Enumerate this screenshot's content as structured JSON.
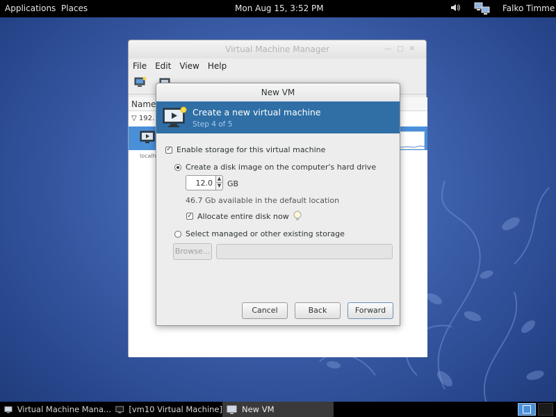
{
  "top_panel": {
    "applications": "Applications",
    "places": "Places",
    "clock": "Mon Aug 15,  3:52 PM",
    "volume_icon": "speaker-icon",
    "network_icon": "network-icon",
    "user": "Falko Timme"
  },
  "vmm_window": {
    "title": "Virtual Machine Manager",
    "menu": [
      "File",
      "Edit",
      "View",
      "Help"
    ],
    "column_name": "Name",
    "group_label": "192.",
    "sub_label": "localh"
  },
  "dialog": {
    "title": "New VM",
    "header_title": "Create a new virtual machine",
    "header_step": "Step 4 of 5",
    "enable_storage_label": "Enable storage for this virtual machine",
    "enable_storage_checked": true,
    "create_disk_label": "Create a disk image on the computer's hard drive",
    "create_disk_selected": true,
    "disk_size_value": "12.0",
    "disk_size_unit": "GB",
    "available_text": "46.7 Gb available in the default location",
    "allocate_label": "Allocate entire disk now",
    "allocate_checked": true,
    "select_managed_label": "Select managed or other existing storage",
    "browse_label": "Browse...",
    "cancel_label": "Cancel",
    "back_label": "Back",
    "forward_label": "Forward"
  },
  "taskbar": {
    "tasks": [
      {
        "label": "Virtual Machine Mana...",
        "active": false
      },
      {
        "label": "[vm10 Virtual Machine]",
        "active": false
      },
      {
        "label": "New VM",
        "active": true
      }
    ]
  },
  "colors": {
    "header_bg": "#2f6fa6",
    "selection": "#4a90d9",
    "panel": "#000000"
  }
}
